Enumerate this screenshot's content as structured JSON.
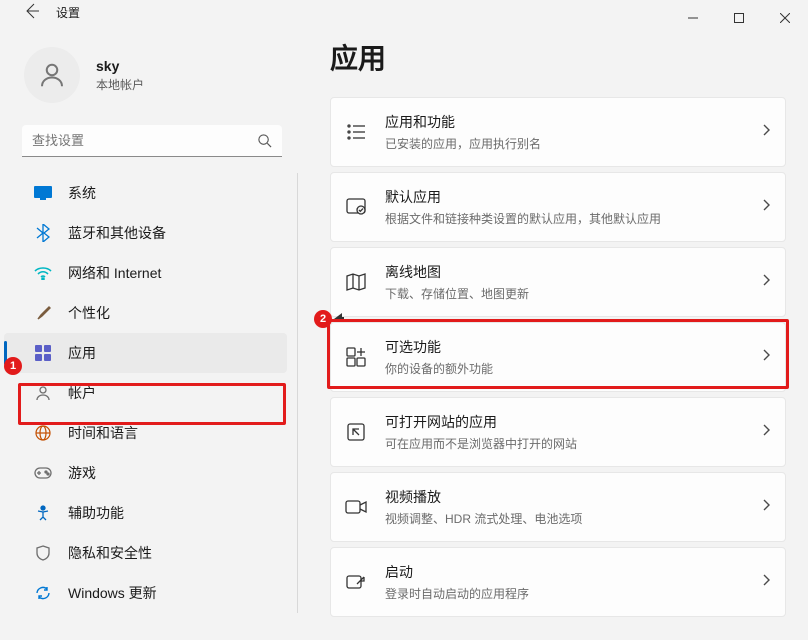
{
  "window": {
    "title": "设置"
  },
  "user": {
    "name": "sky",
    "subtitle": "本地帐户"
  },
  "search": {
    "placeholder": "查找设置"
  },
  "sidebar": {
    "items": [
      {
        "label": "系统"
      },
      {
        "label": "蓝牙和其他设备"
      },
      {
        "label": "网络和 Internet"
      },
      {
        "label": "个性化"
      },
      {
        "label": "应用"
      },
      {
        "label": "帐户"
      },
      {
        "label": "时间和语言"
      },
      {
        "label": "游戏"
      },
      {
        "label": "辅助功能"
      },
      {
        "label": "隐私和安全性"
      },
      {
        "label": "Windows 更新"
      }
    ]
  },
  "main": {
    "title": "应用",
    "cards": [
      {
        "title": "应用和功能",
        "sub": "已安装的应用，应用执行别名"
      },
      {
        "title": "默认应用",
        "sub": "根据文件和链接种类设置的默认应用，其他默认应用"
      },
      {
        "title": "离线地图",
        "sub": "下载、存储位置、地图更新"
      },
      {
        "title": "可选功能",
        "sub": "你的设备的额外功能"
      },
      {
        "title": "可打开网站的应用",
        "sub": "可在应用而不是浏览器中打开的网站"
      },
      {
        "title": "视频播放",
        "sub": "视频调整、HDR 流式处理、电池选项"
      },
      {
        "title": "启动",
        "sub": "登录时自动启动的应用程序"
      }
    ]
  },
  "annotations": {
    "badge1": "1",
    "badge2": "2"
  }
}
